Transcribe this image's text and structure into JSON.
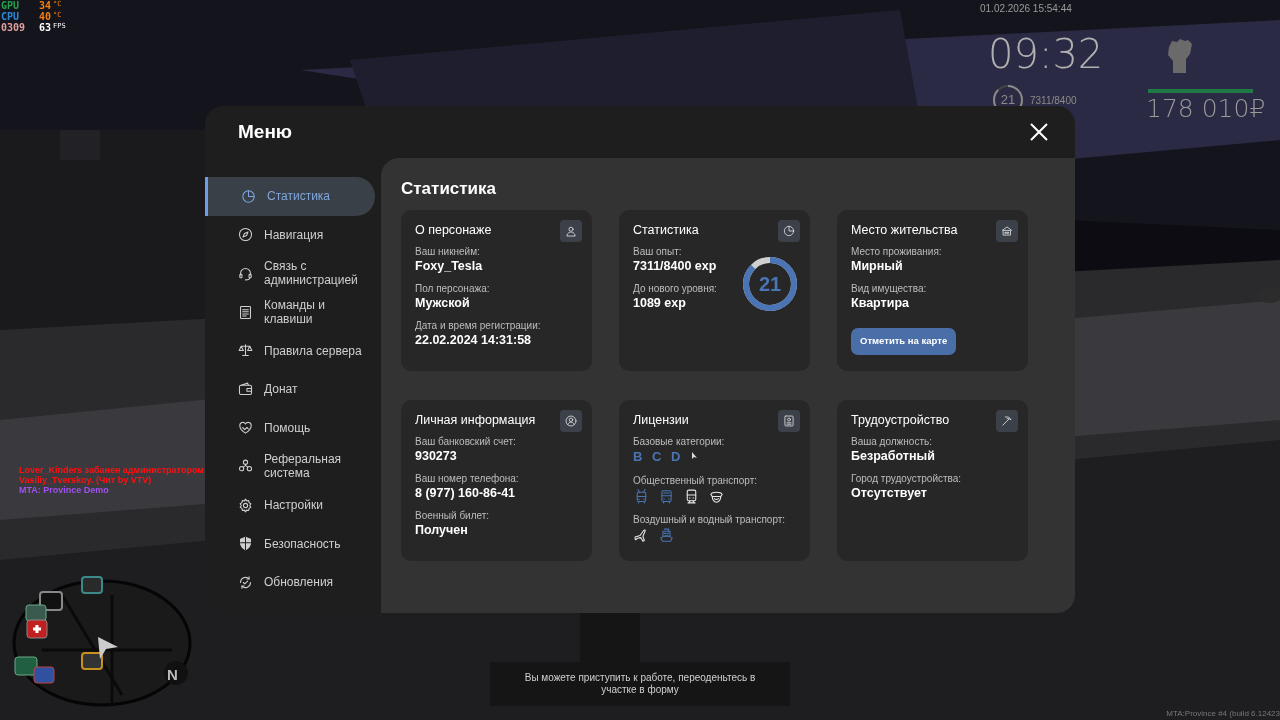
{
  "perf_overlay": [
    {
      "label": "GPU",
      "value": "34",
      "unit": "°C",
      "color": "#22a04a"
    },
    {
      "label": "CPU",
      "value": "40",
      "unit": "°C",
      "color": "#2a8ad8"
    },
    {
      "label": "0309",
      "value": "63",
      "unit": "FPS",
      "color": "#e0a0a0"
    }
  ],
  "hud": {
    "date": "01.02.2026 15:54:44",
    "clock": "09:32",
    "player_level": "21",
    "level": 0.87,
    "experience": "7311/8400",
    "health": {
      "level": 1
    },
    "money": "178 010₽"
  },
  "chat": [
    {
      "text": "Lover_Kinders забанен администратором Vasiliy_Tverskoy. (Чит by VTV)",
      "color": "#ff1010"
    },
    {
      "text": "MTA: Province Demo",
      "color": "#a050f0"
    }
  ],
  "menu": {
    "title": "Меню",
    "sidebar": {
      "items": [
        {
          "label": "Статистика",
          "selected": true
        },
        {
          "label": "Навигация",
          "selected": false
        },
        {
          "label": "Связь с администрацией",
          "selected": false
        },
        {
          "label": "Команды и клавиши",
          "selected": false
        },
        {
          "label": "Правила сервера",
          "selected": false
        },
        {
          "label": "Донат",
          "selected": false
        },
        {
          "label": "Помощь",
          "selected": false
        },
        {
          "label": "Реферальная система",
          "selected": false
        },
        {
          "label": "Настройки",
          "selected": false
        },
        {
          "label": "Безопасность",
          "selected": false
        },
        {
          "label": "Обновления",
          "selected": false
        }
      ]
    },
    "content": {
      "title": "Статистика",
      "cards": [
        {
          "kind": "fields",
          "title": "О персонаже",
          "fields": [
            {
              "label": "Ваш никнейм:",
              "value": "Foxy_Tesla"
            },
            {
              "label": "Пол персонажа:",
              "value": "Мужской"
            },
            {
              "label": "Дата и время регистрации:",
              "value": "22.02.2024 14:31:58"
            }
          ]
        },
        {
          "kind": "stats",
          "title": "Статистика",
          "fields": [
            {
              "label": "Ваш опыт:",
              "value": "7311/8400 exp"
            },
            {
              "label": "До нового уровня:",
              "value": "1089 exp"
            }
          ],
          "ring": {
            "value": "21",
            "level": 0.87
          }
        },
        {
          "kind": "fields",
          "title": "Место жительства",
          "fields": [
            {
              "label": "Место проживания:",
              "value": "Мирный"
            },
            {
              "label": "Вид имущества:",
              "value": "Квартира"
            }
          ],
          "button": "Отметить на карте"
        },
        {
          "kind": "fields",
          "title": "Личная информация",
          "fields": [
            {
              "label": "Ваш банковский счет:",
              "value": "930273"
            },
            {
              "label": "Ваш номер телефона:",
              "value": "8 (977) 160-86-41"
            },
            {
              "label": "Военный билет:",
              "value": "Получен"
            }
          ]
        },
        {
          "kind": "licenses",
          "title": "Лицензии",
          "groups": [
            {
              "label": "Базовые категории:",
              "kind": "letters",
              "items": [
                {
                  "text": "B",
                  "owned": true
                },
                {
                  "text": "C",
                  "owned": true
                },
                {
                  "text": "D",
                  "owned": true
                }
              ]
            },
            {
              "label": "Общественный транспорт:",
              "kind": "icons",
              "items": [
                {
                  "owned": true
                },
                {
                  "owned": true
                },
                {
                  "owned": false
                },
                {
                  "owned": false
                }
              ]
            },
            {
              "label": "Воздушный и водный транспорт:",
              "kind": "icons",
              "items": [
                {
                  "owned": false
                },
                {
                  "owned": true
                }
              ]
            }
          ]
        },
        {
          "kind": "fields",
          "title": "Трудоустройство",
          "fields": [
            {
              "label": "Ваша должность:",
              "value": "Безработный"
            },
            {
              "label": "Город трудоустройства:",
              "value": "Отсутствует"
            }
          ]
        }
      ]
    }
  },
  "notification": "Вы можете приступить к работе, переоденьтесь в участке в форму",
  "minimap": {
    "north_label": "N"
  },
  "build_label": "MTA:Province #4 (build 6.12423"
}
